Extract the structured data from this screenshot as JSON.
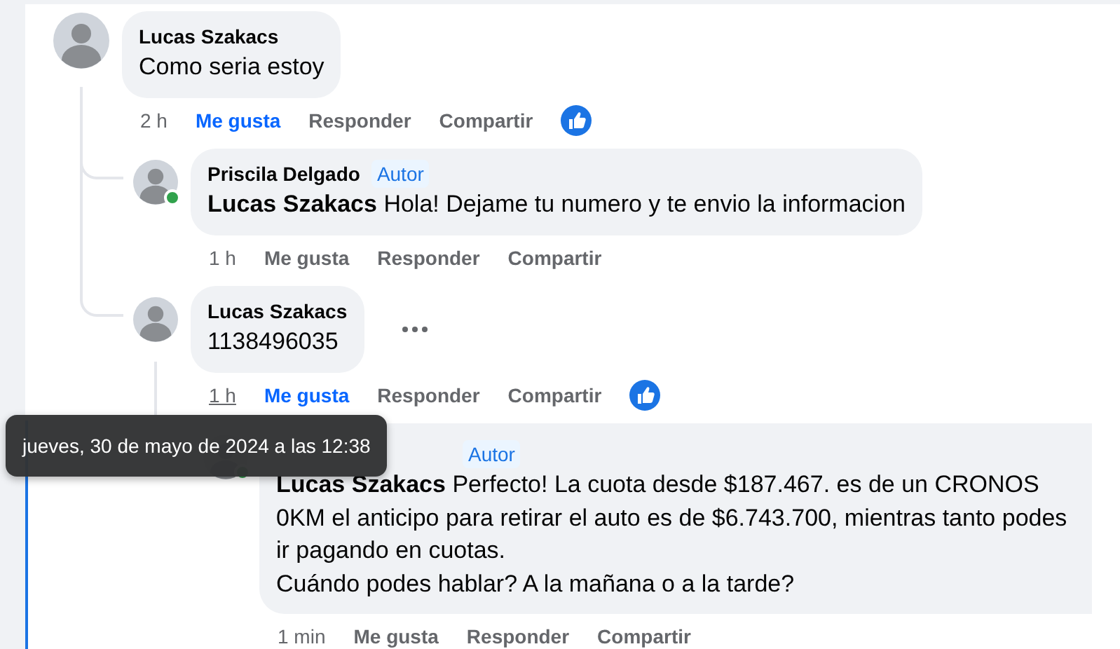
{
  "comments": [
    {
      "author": "Lucas Szakacs",
      "text": "Como seria estoy",
      "time": "2 h",
      "time_hovered": false,
      "liked": true,
      "reacted": true,
      "menu": false,
      "actions": {
        "like": "Me gusta",
        "reply": "Responder",
        "share": "Compartir"
      },
      "children": [
        {
          "author": "Priscila Delgado",
          "badge": "Autor",
          "online": true,
          "text": "**Lucas Szakacs** Hola! Dejame tu numero y te envio la informacion",
          "time": "1 h",
          "time_hovered": false,
          "liked": false,
          "reacted": false,
          "menu": false,
          "actions": {
            "like": "Me gusta",
            "reply": "Responder",
            "share": "Compartir"
          }
        },
        {
          "author": "Lucas Szakacs",
          "text": "1138496035",
          "time": "1 h",
          "time_hovered": true,
          "liked": true,
          "reacted": true,
          "menu": true,
          "actions": {
            "like": "Me gusta",
            "reply": "Responder",
            "share": "Compartir"
          },
          "children": [
            {
              "badge": "Autor",
              "online": true,
              "text": "**Lucas Szakacs** Perfecto! La cuota desde $187.467. es de un CRONOS 0KM el anticipo para retirar el auto es de $6.743.700, mientras tanto podes ir pagando en cuotas.\nCuándo podes hablar? A la mañana o a la tarde?",
              "time": "1 min",
              "time_hovered": false,
              "liked": false,
              "reacted": false,
              "menu": false,
              "actions": {
                "like": "Me gusta",
                "reply": "Responder",
                "share": "Compartir"
              }
            }
          ]
        }
      ]
    }
  ],
  "tooltip": {
    "text": "jueves, 30 de mayo de 2024 a las 12:38"
  }
}
